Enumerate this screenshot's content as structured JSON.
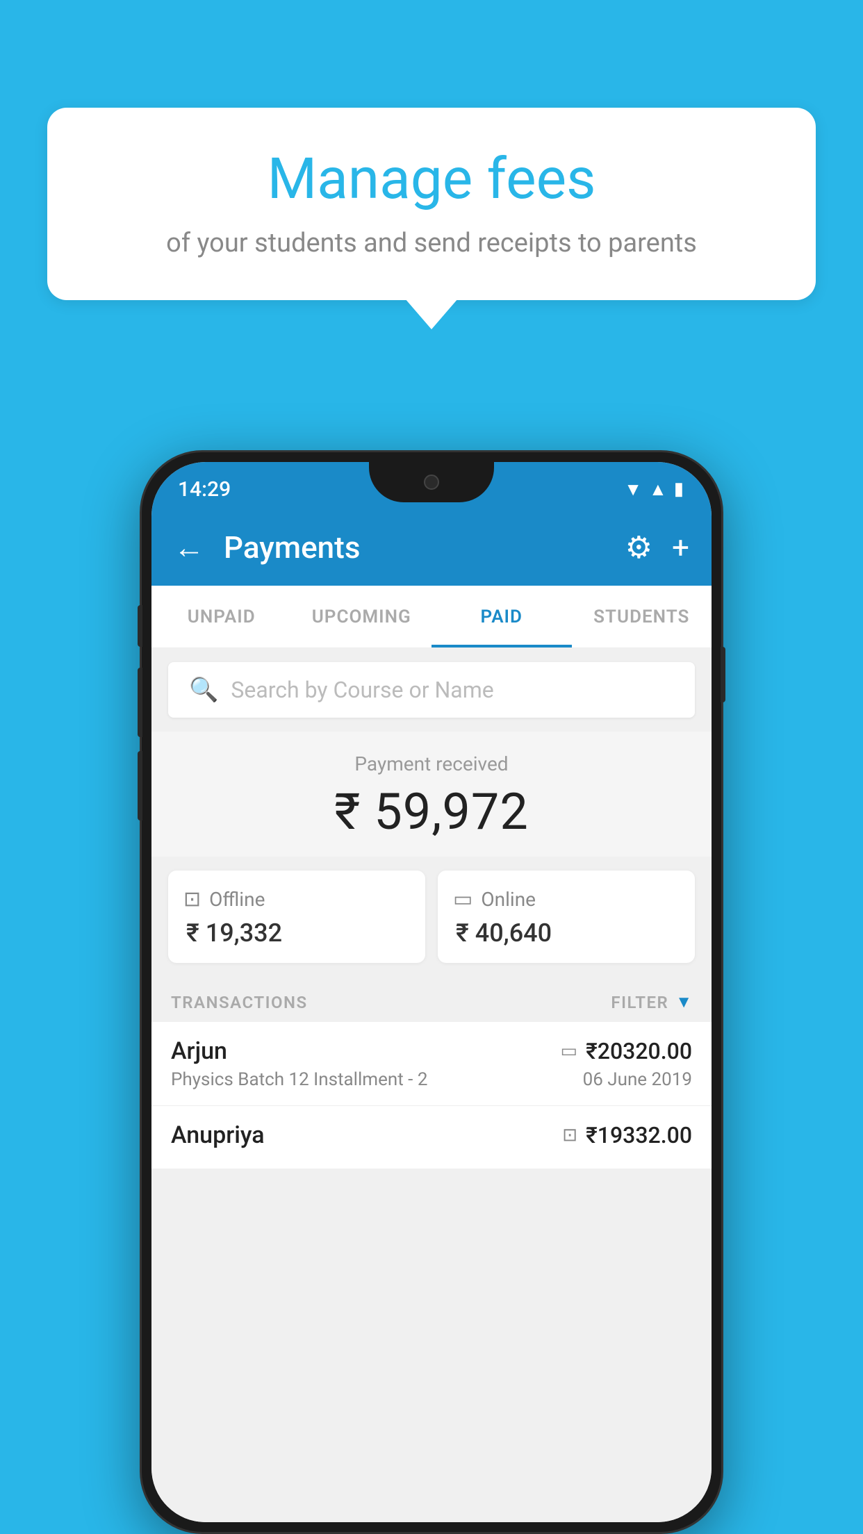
{
  "background_color": "#29b6e8",
  "speech_bubble": {
    "title": "Manage fees",
    "subtitle": "of your students and send receipts to parents"
  },
  "status_bar": {
    "time": "14:29"
  },
  "app_bar": {
    "title": "Payments",
    "back_label": "←",
    "settings_label": "⚙",
    "add_label": "+"
  },
  "tabs": [
    {
      "label": "UNPAID",
      "active": false
    },
    {
      "label": "UPCOMING",
      "active": false
    },
    {
      "label": "PAID",
      "active": true
    },
    {
      "label": "STUDENTS",
      "active": false
    }
  ],
  "search": {
    "placeholder": "Search by Course or Name"
  },
  "payment_received": {
    "label": "Payment received",
    "amount": "₹ 59,972"
  },
  "payment_cards": {
    "offline": {
      "label": "Offline",
      "amount": "₹ 19,332"
    },
    "online": {
      "label": "Online",
      "amount": "₹ 40,640"
    }
  },
  "transactions": {
    "header": "TRANSACTIONS",
    "filter_label": "FILTER",
    "items": [
      {
        "name": "Arjun",
        "course": "Physics Batch 12 Installment - 2",
        "amount": "₹20320.00",
        "date": "06 June 2019",
        "type": "online"
      },
      {
        "name": "Anupriya",
        "course": "",
        "amount": "₹19332.00",
        "date": "",
        "type": "offline"
      }
    ]
  }
}
